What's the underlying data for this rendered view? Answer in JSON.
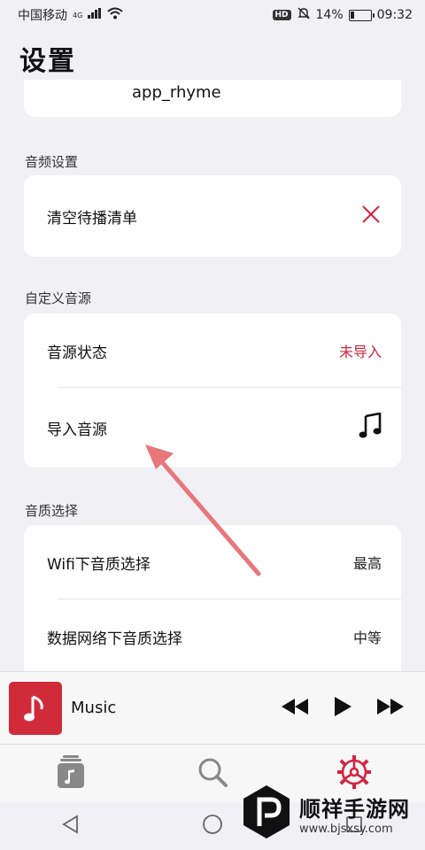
{
  "status_bar": {
    "carrier": "中国移动",
    "network_tag": "4G",
    "hd_label": "HD",
    "battery": "14%",
    "time": "09:32"
  },
  "header": {
    "title": "设置"
  },
  "top_card": {
    "value": "app_rhyme"
  },
  "sections": {
    "audio": {
      "label": "音频设置",
      "clear_queue": "清空待播清单"
    },
    "custom_source": {
      "label": "自定义音源",
      "status_label": "音源状态",
      "status_value": "未导入",
      "import_label": "导入音源"
    },
    "quality": {
      "label": "音质选择",
      "wifi_label": "Wifi下音质选择",
      "wifi_value": "最高",
      "mobile_label": "数据网络下音质选择",
      "mobile_value": "中等"
    }
  },
  "player": {
    "title": "Music"
  },
  "tabs": [
    {
      "icon": "library-icon"
    },
    {
      "icon": "search-icon"
    },
    {
      "icon": "settings-icon",
      "active": true
    }
  ],
  "colors": {
    "accent": "#d2243f",
    "arrow": "#e8767a"
  },
  "watermark": {
    "title": "顺祥手游网",
    "url": "www.bjsxsy.com"
  }
}
